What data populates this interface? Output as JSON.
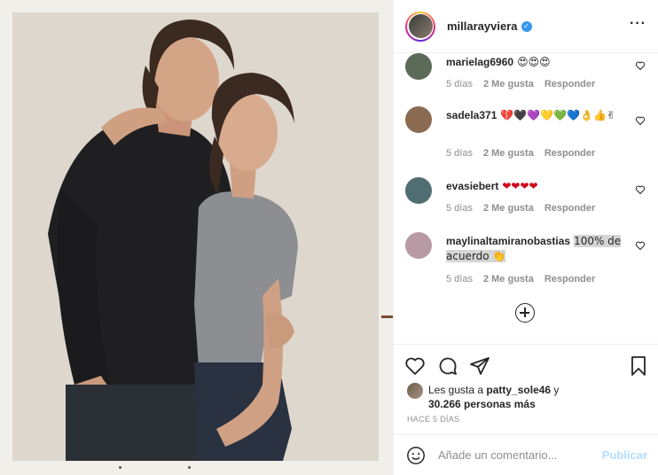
{
  "post": {
    "username": "millarayviera",
    "verified_mark": "✓"
  },
  "header": {
    "more_icon": "more-horizontal-icon",
    "more_glyph": "···"
  },
  "comments": [
    {
      "user": "marielag6960",
      "text": "😍😍😍",
      "time": "5 días",
      "likes": "2 Me gusta",
      "reply": "Responder",
      "avatar_color": "#5c6b58"
    },
    {
      "user": "sadela371",
      "text": "💔🖤💜💛💚💙👌👍✌",
      "time": "5 días",
      "likes": "2 Me gusta",
      "reply": "Responder",
      "avatar_color": "#8a6b52"
    },
    {
      "user": "evasiebert",
      "text": "❤❤❤❤",
      "time": "5 días",
      "likes": "2 Me gusta",
      "reply": "Responder",
      "avatar_color": "#4f6e72"
    },
    {
      "user": "maylinaltamiranobastias",
      "text_hl": "100% de acuerdo 👏",
      "time": "5 días",
      "likes": "2 Me gusta",
      "reply": "Responder",
      "avatar_color": "#b89aa4"
    }
  ],
  "likes": {
    "prefix": "Les gusta a ",
    "user": "patty_sole46",
    "mid": " y",
    "count": "30.266 personas más"
  },
  "timeago": "HACE 5 DÍAS",
  "add_comment": {
    "placeholder": "Añade un comentario...",
    "publish": "Publicar"
  },
  "colors": {
    "accent": "#0095f6",
    "publish_disabled": "#b2dffc",
    "meta": "#8e8e8e",
    "verified": "#3897f0"
  }
}
